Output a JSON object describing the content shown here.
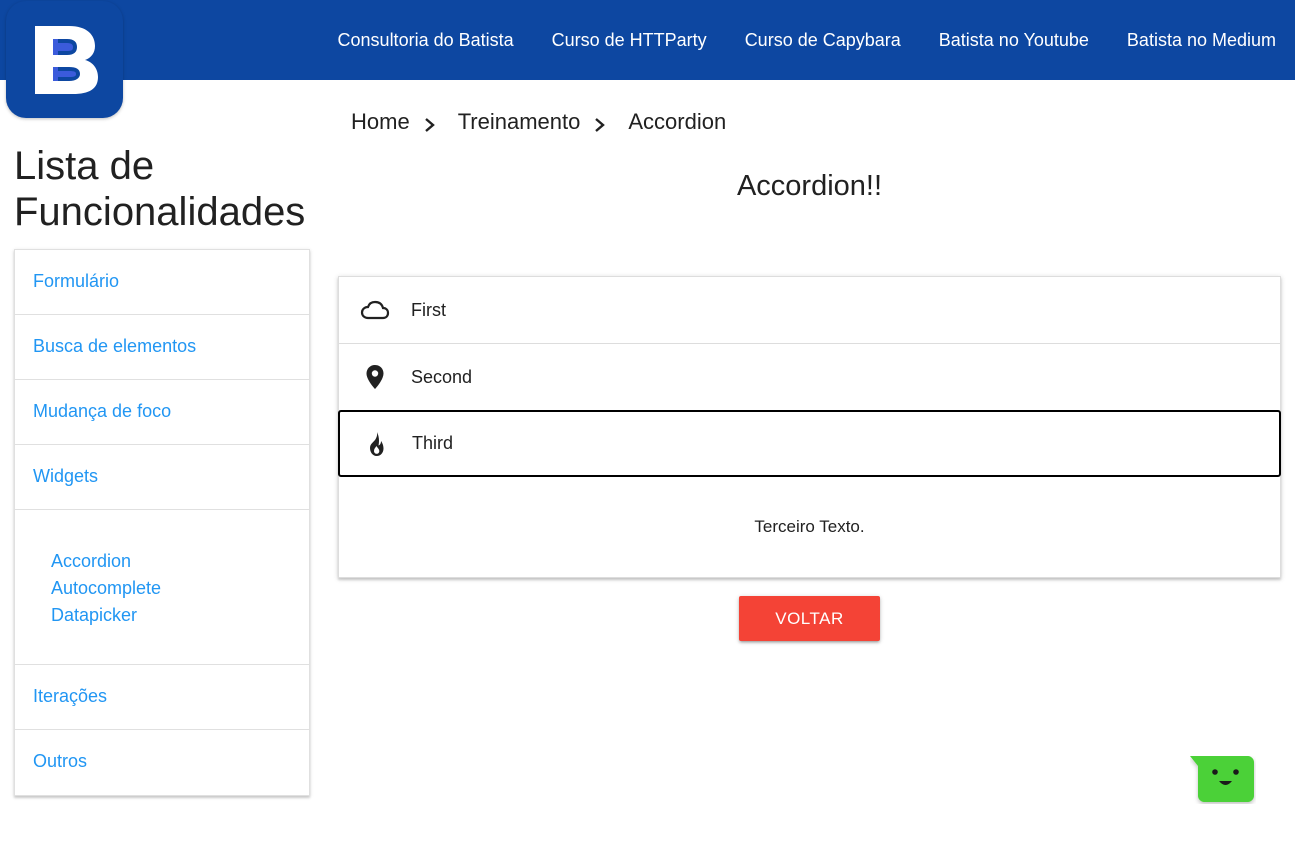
{
  "header": {
    "logo_letter": "B",
    "brand_color": "#0d47a1",
    "nav": [
      {
        "label": "Consultoria do Batista"
      },
      {
        "label": "Curso de HTTParty"
      },
      {
        "label": "Curso de Capybara"
      },
      {
        "label": "Batista no Youtube"
      },
      {
        "label": "Batista no Medium"
      }
    ]
  },
  "sidebar": {
    "title": "Lista de Funcionalidades",
    "items": [
      {
        "label": "Formulário"
      },
      {
        "label": "Busca de elementos"
      },
      {
        "label": "Mudança de foco"
      },
      {
        "label": "Widgets"
      }
    ],
    "subitems": [
      {
        "label": "Accordion"
      },
      {
        "label": "Autocomplete"
      },
      {
        "label": "Datapicker"
      }
    ],
    "items_after": [
      {
        "label": "Iterações"
      },
      {
        "label": "Outros"
      }
    ],
    "link_color": "#2196f3"
  },
  "breadcrumb": {
    "items": [
      "Home",
      "Treinamento",
      "Accordion"
    ]
  },
  "main": {
    "title": "Accordion!!",
    "accordion": [
      {
        "label": "First",
        "icon": "cloud-icon"
      },
      {
        "label": "Second",
        "icon": "place-icon"
      },
      {
        "label": "Third",
        "icon": "whatshot-icon",
        "active": true
      }
    ],
    "active_body": "Terceiro Texto.",
    "back_button": "VOLTAR",
    "back_button_color": "#f44336"
  },
  "chat_widget": {
    "icon": "chat-smiley-icon",
    "color": "#4cd137"
  }
}
